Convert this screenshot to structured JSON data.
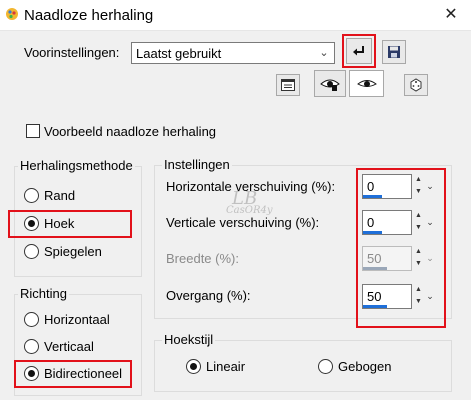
{
  "window": {
    "title": "Naadloze herhaling",
    "close": "✕"
  },
  "presets": {
    "label": "Voorinstellingen:",
    "value": "Laatst gebruikt"
  },
  "preview": {
    "label": "Voorbeeld naadloze herhaling",
    "checked": false
  },
  "method": {
    "title": "Herhalingsmethode",
    "options": [
      "Rand",
      "Hoek",
      "Spiegelen"
    ],
    "selected": "Hoek"
  },
  "direction": {
    "title": "Richting",
    "options": [
      "Horizontaal",
      "Verticaal",
      "Bidirectioneel"
    ],
    "selected": "Bidirectioneel"
  },
  "settings": {
    "title": "Instellingen",
    "fields": [
      {
        "label": "Horizontale verschuiving (%):",
        "value": "0",
        "level_percent": 0,
        "enabled": true
      },
      {
        "label": "Verticale verschuiving (%):",
        "value": "0",
        "level_percent": 0,
        "enabled": true
      },
      {
        "label": "Breedte (%):",
        "value": "50",
        "level_percent": 50,
        "enabled": false
      },
      {
        "label": "Overgang (%):",
        "value": "50",
        "level_percent": 50,
        "enabled": true
      }
    ]
  },
  "corner_style": {
    "title": "Hoekstijl",
    "options": [
      "Lineair",
      "Gebogen"
    ],
    "selected": "Lineair"
  },
  "watermark": {
    "line1": "LB",
    "line2": "CasOR4y"
  },
  "colors": {
    "highlight": "#e2111a",
    "accent": "#1e6fd9"
  }
}
